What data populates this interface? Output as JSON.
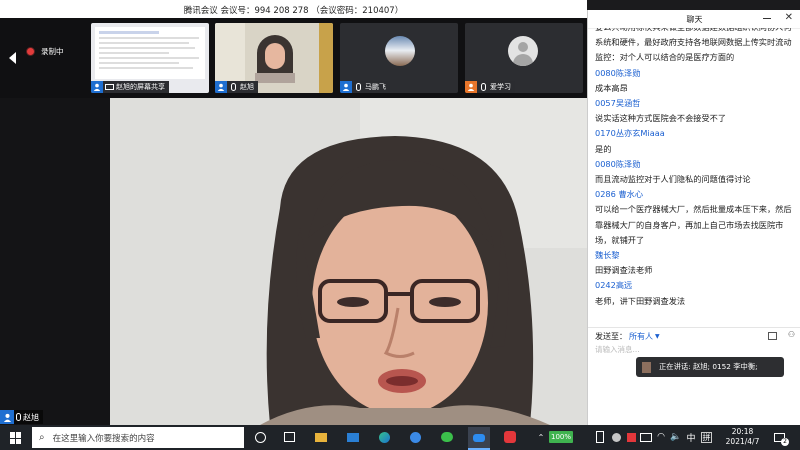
{
  "window": {
    "title": "腾讯会议 会议号：994 208 278 （会议密码：210407）"
  },
  "recording": {
    "label": "录制中"
  },
  "tiles": [
    {
      "label": "赵旭的屏幕共享"
    },
    {
      "label": "赵旭"
    },
    {
      "label": "马鹏飞"
    },
    {
      "label": "爱学习"
    }
  ],
  "main_video": {
    "label": "赵旭"
  },
  "chat": {
    "title": "聊天",
    "messages": [
      {
        "type": "text",
        "text": "要么共动用标筷具来做全部数据建数据组织认向协人何"
      },
      {
        "type": "text",
        "text": "系统和硬件，最好政府支持各地联网数据上传实时流动"
      },
      {
        "type": "text",
        "text": "监控：对个人可以结合的是医疗方面的"
      },
      {
        "type": "name",
        "text": "0080陈泽勋"
      },
      {
        "type": "text",
        "text": "成本高昂"
      },
      {
        "type": "name",
        "text": "0057吴涵哲"
      },
      {
        "type": "text",
        "text": "说实话这种方式医院会不会接受不了"
      },
      {
        "type": "name",
        "text": "0170丛亦玄Miaaa"
      },
      {
        "type": "text",
        "text": "是的"
      },
      {
        "type": "name",
        "text": "0080陈泽勋"
      },
      {
        "type": "text",
        "text": "而且流动监控对于人们隐私的问题值得讨论"
      },
      {
        "type": "name",
        "text": "0286 曹水心"
      },
      {
        "type": "text",
        "text": "可以给一个医疗器械大厂，然后批量成本压下来，然后"
      },
      {
        "type": "text",
        "text": "靠器械大厂的自身客户，再加上自己市场去找医院市"
      },
      {
        "type": "text",
        "text": "场，就铺开了"
      },
      {
        "type": "name",
        "text": "魏长黎"
      },
      {
        "type": "text",
        "text": "田野调查法老师"
      },
      {
        "type": "name",
        "text": "0242高远"
      },
      {
        "type": "text",
        "text": "老师，讲下田野调查发法"
      }
    ],
    "send_to_label": "发送至：",
    "send_to_value": "所有人",
    "input_placeholder": "请输入消息..."
  },
  "speaking": {
    "text": "正在讲话: 赵旭; 0152 李中衡;"
  },
  "taskbar": {
    "search_placeholder": "在这里输入你要搜索的内容",
    "battery": "100%",
    "ime_lang": "中",
    "ime_mode": "拼",
    "time": "20:18",
    "date": "2021/4/7",
    "notification_count": "2"
  },
  "colors": {
    "accent_blue": "#1a5fd0",
    "taskbar": "#1f2328",
    "tile_user": "#1f6fd1"
  }
}
